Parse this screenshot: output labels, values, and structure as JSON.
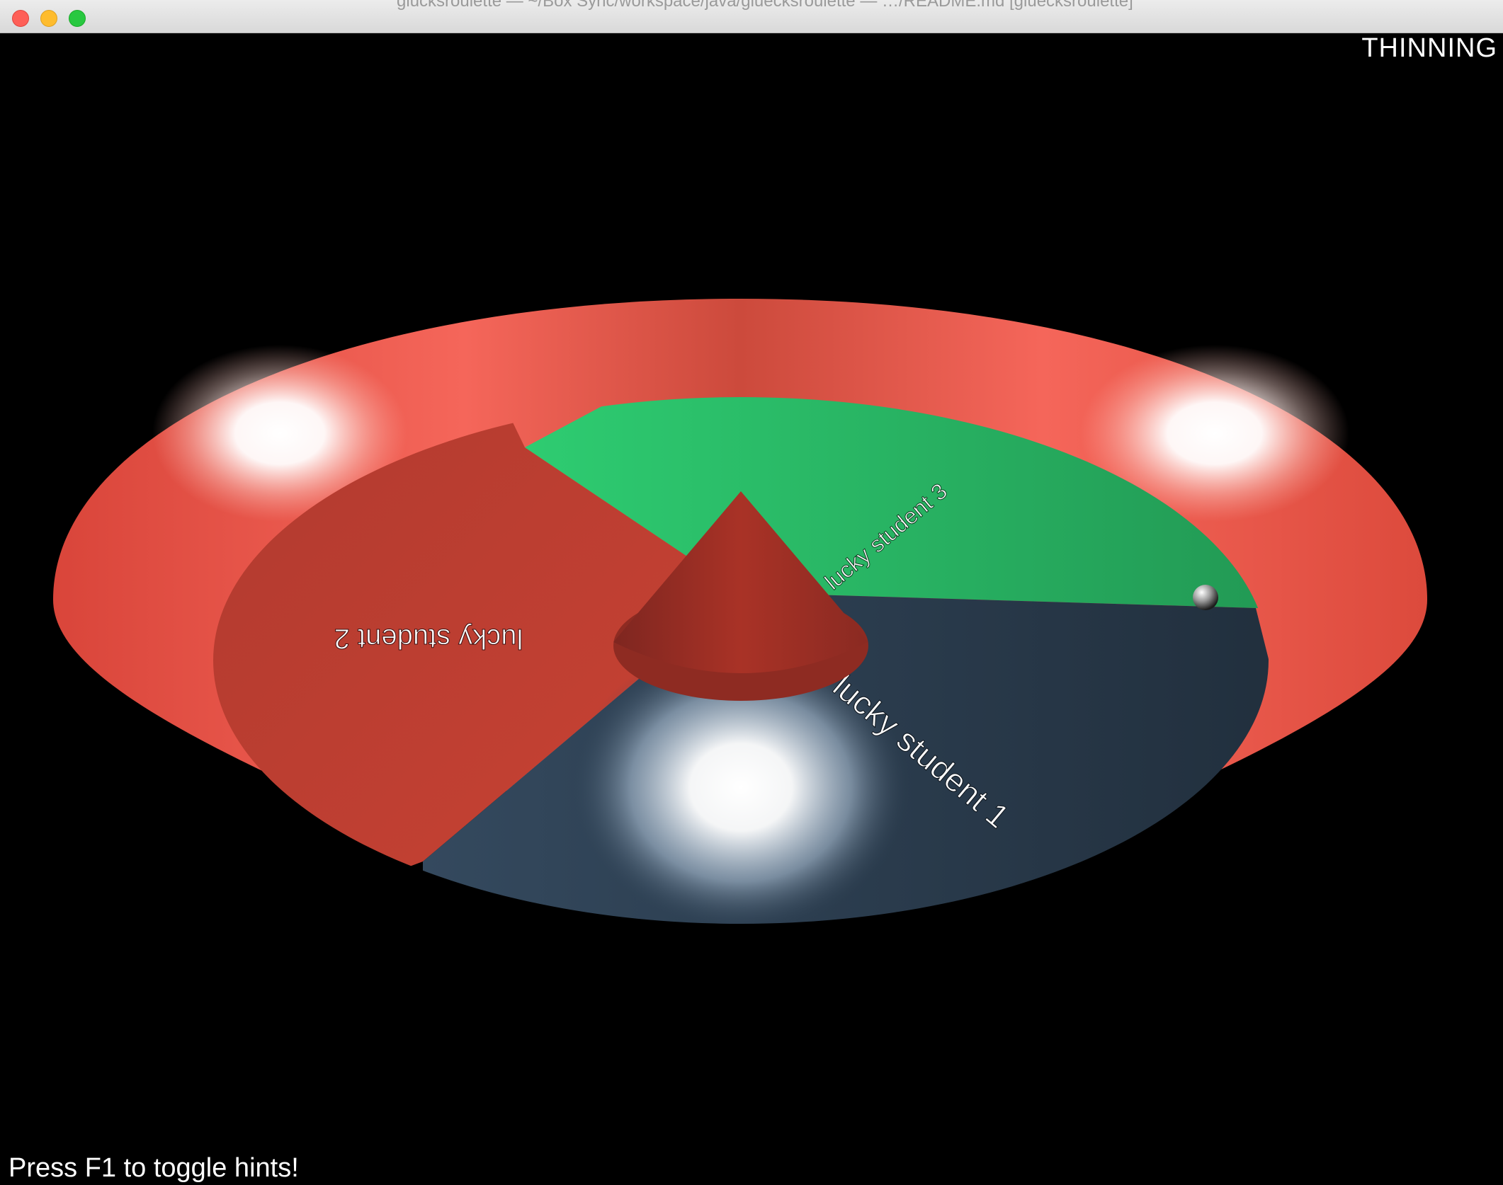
{
  "window": {
    "title": "glücksroulette — ~/Box Sync/workspace/java/gluecksroulette — …/README.md [gluecksroulette]"
  },
  "hud": {
    "mode": "THINNING",
    "hint": "Press F1 to toggle hints!"
  },
  "wheel": {
    "rim_color": "#e74c3c",
    "segments": [
      {
        "label": "lucky student 1",
        "color": "#2c3e50"
      },
      {
        "label": "lucky student 2",
        "color": "#c0392b"
      },
      {
        "label": "lucky student 3",
        "color": "#27ae60"
      }
    ],
    "center_cone_color": "#a93226",
    "ball_color": "#dddddd"
  }
}
